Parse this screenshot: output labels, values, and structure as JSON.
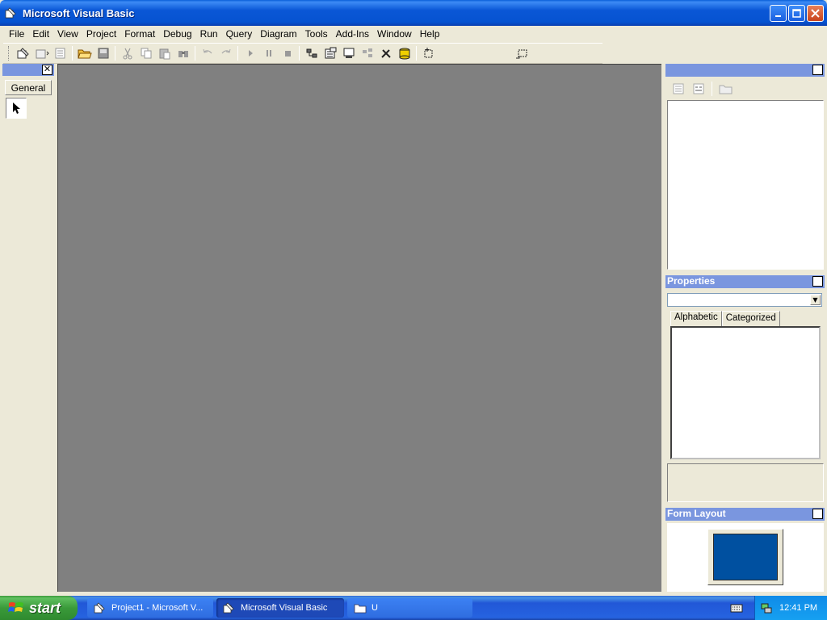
{
  "window": {
    "title": "Microsoft Visual Basic",
    "icon": "vb-app-icon"
  },
  "menu": [
    {
      "label": "File"
    },
    {
      "label": "Edit"
    },
    {
      "label": "View"
    },
    {
      "label": "Project"
    },
    {
      "label": "Format"
    },
    {
      "label": "Debug"
    },
    {
      "label": "Run"
    },
    {
      "label": "Query"
    },
    {
      "label": "Diagram"
    },
    {
      "label": "Tools"
    },
    {
      "label": "Add-Ins"
    },
    {
      "label": "Window"
    },
    {
      "label": "Help"
    }
  ],
  "toolbar": {
    "icons": [
      "add-project-icon",
      "add-form-icon",
      "menu-editor-icon",
      "open-project-icon",
      "save-project-icon",
      "cut-icon",
      "copy-icon",
      "paste-icon",
      "find-icon",
      "undo-icon",
      "redo-icon",
      "start-icon",
      "break-icon",
      "end-icon",
      "project-explorer-icon",
      "properties-window-icon",
      "form-layout-icon",
      "object-browser-icon",
      "toolbox-icon",
      "data-view-icon",
      "component-manager-icon"
    ]
  },
  "toolbox": {
    "tab_label": "General",
    "pointer_tool": "pointer-icon"
  },
  "project_panel": {
    "buttons": [
      "view-code-icon",
      "view-object-icon",
      "toggle-folders-icon"
    ]
  },
  "properties": {
    "title": "Properties",
    "tabs": [
      "Alphabetic",
      "Categorized"
    ],
    "object_combo_value": ""
  },
  "form_layout": {
    "title": "Form Layout"
  },
  "taskbar": {
    "start_label": "start",
    "tasks": [
      {
        "label": "Project1 - Microsoft V...",
        "active": false
      },
      {
        "label": "Microsoft Visual Basic",
        "active": true
      },
      {
        "label": "U",
        "active": false
      }
    ],
    "clock": "12:41 PM"
  },
  "colors": {
    "titlebar": "#0a57d6",
    "mdi_background": "#808080",
    "panel_header": "#7a96df",
    "form_layout_screen": "#0050a0"
  }
}
